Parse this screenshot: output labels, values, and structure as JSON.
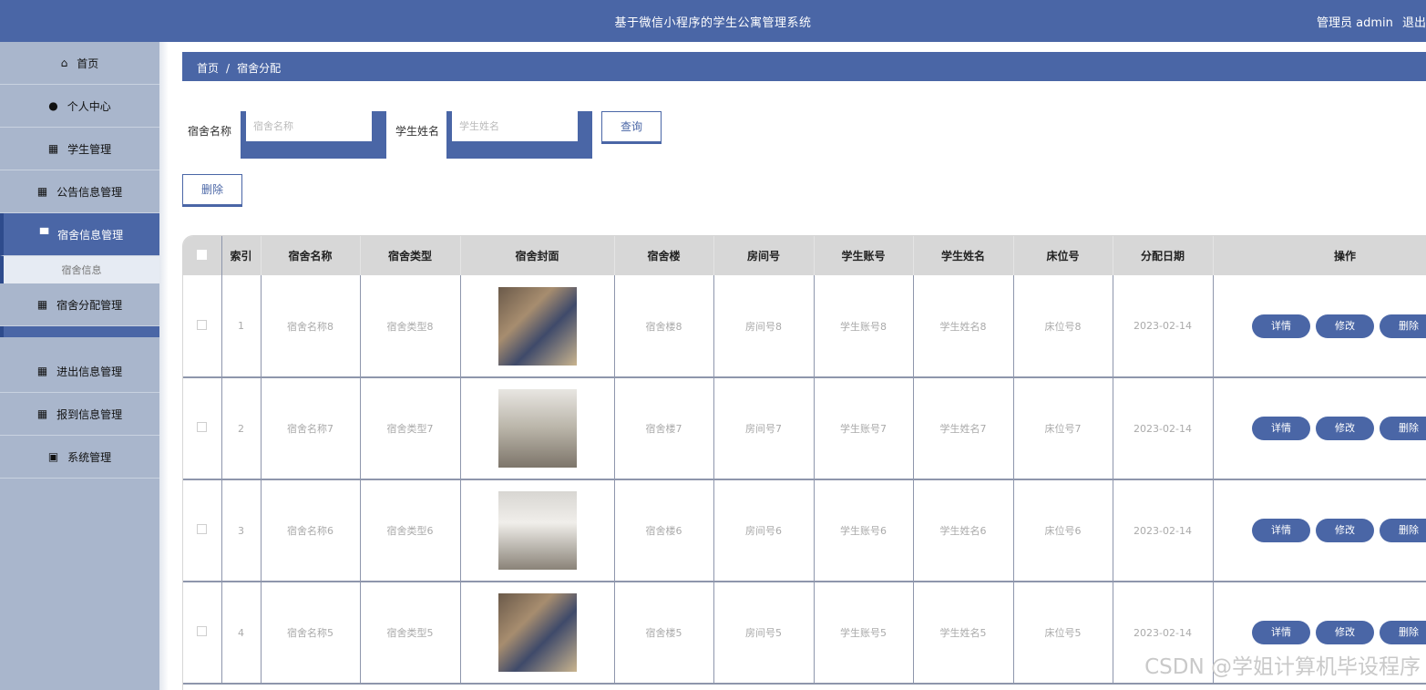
{
  "header": {
    "title": "基于微信小程序的学生公寓管理系统",
    "role": "管理员 admin",
    "logout": "退出"
  },
  "sidebar": {
    "items": [
      {
        "label": "首页",
        "icon": "home-icon",
        "glyph": "⌂"
      },
      {
        "label": "个人中心",
        "icon": "user-icon",
        "glyph": "●"
      },
      {
        "label": "学生管理",
        "icon": "grid-icon",
        "glyph": "▦"
      },
      {
        "label": "公告信息管理",
        "icon": "grid-icon",
        "glyph": "▦"
      },
      {
        "label": "宿舍信息管理",
        "icon": "building-icon",
        "glyph": "▀"
      },
      {
        "label": "宿舍分配管理",
        "icon": "grid-icon",
        "glyph": "▦"
      },
      {
        "label": "进出信息管理",
        "icon": "grid-icon",
        "glyph": "▦"
      },
      {
        "label": "报到信息管理",
        "icon": "grid-icon",
        "glyph": "▦"
      },
      {
        "label": "系统管理",
        "icon": "settings-icon",
        "glyph": "▣"
      }
    ],
    "sub_item": "宿舍信息"
  },
  "breadcrumb": {
    "home": "首页",
    "separator": "/",
    "current": "宿舍分配"
  },
  "search": {
    "name_label": "宿舍名称",
    "name_placeholder": "宿舍名称",
    "student_label": "学生姓名",
    "student_placeholder": "学生姓名",
    "query_button": "查询"
  },
  "delete_button": "删除",
  "table": {
    "columns": [
      "索引",
      "宿舍名称",
      "宿舍类型",
      "宿舍封面",
      "宿舍楼",
      "房间号",
      "学生账号",
      "学生姓名",
      "床位号",
      "分配日期",
      "操作"
    ],
    "rows": [
      {
        "index": "1",
        "name": "宿舍名称8",
        "type": "宿舍类型8",
        "building": "宿舍楼8",
        "room": "房间号8",
        "account": "学生账号8",
        "student": "学生姓名8",
        "bed": "床位号8",
        "date": "2023-02-14"
      },
      {
        "index": "2",
        "name": "宿舍名称7",
        "type": "宿舍类型7",
        "building": "宿舍楼7",
        "room": "房间号7",
        "account": "学生账号7",
        "student": "学生姓名7",
        "bed": "床位号7",
        "date": "2023-02-14"
      },
      {
        "index": "3",
        "name": "宿舍名称6",
        "type": "宿舍类型6",
        "building": "宿舍楼6",
        "room": "房间号6",
        "account": "学生账号6",
        "student": "学生姓名6",
        "bed": "床位号6",
        "date": "2023-02-14"
      },
      {
        "index": "4",
        "name": "宿舍名称5",
        "type": "宿舍类型5",
        "building": "宿舍楼5",
        "room": "房间号5",
        "account": "学生账号5",
        "student": "学生姓名5",
        "bed": "床位号5",
        "date": "2023-02-14"
      }
    ],
    "actions": {
      "detail": "详情",
      "edit": "修改",
      "delete": "删除"
    }
  },
  "watermark": "CSDN @学姐计算机毕设程序",
  "colors": {
    "primary": "#4a66a6",
    "sidebar": "#a9b6cc"
  }
}
